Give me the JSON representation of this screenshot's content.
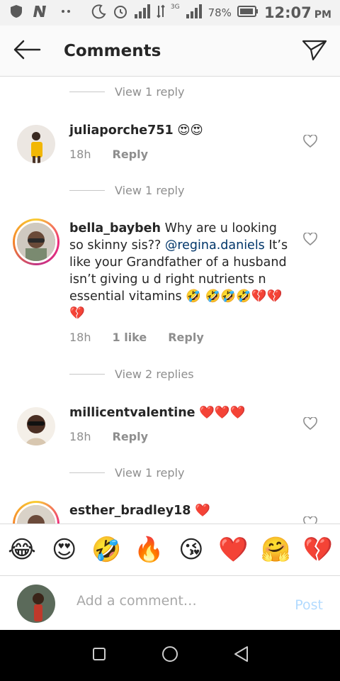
{
  "status_bar": {
    "battery_percent": "78%",
    "time": "12:07",
    "ampm": "PM",
    "network": "3G"
  },
  "header": {
    "title": "Comments"
  },
  "comments": [
    {
      "view_replies_above": "View 1 reply"
    },
    {
      "username": "juliaporche751",
      "text": "😍😍",
      "time": "18h",
      "reply_label": "Reply",
      "likes": ""
    },
    {
      "view_replies_above": "View 1 reply",
      "username": "bella_baybeh",
      "text_before_mention": "Why are u looking so skinny sis?? ",
      "mention": "@regina.daniels",
      "text_after_mention": " It’s like your Grandfather of a husband isn’t giving u d right nutrients n essential vitamins 🤣 🤣🤣🤣💔💔💔",
      "time": "18h",
      "likes": "1 like",
      "reply_label": "Reply"
    },
    {
      "view_replies_above": "View 2 replies",
      "username": "millicentvalentine",
      "text": "❤️❤️❤️",
      "time": "18h",
      "reply_label": "Reply"
    },
    {
      "view_replies_above": "View 1 reply",
      "username": "esther_bradley18",
      "text": "❤️"
    }
  ],
  "emoji_bar": [
    "😂",
    "😍",
    "🤣",
    "🔥",
    "😘",
    "❤️",
    "🤗",
    "💔"
  ],
  "composer": {
    "placeholder": "Add a comment…",
    "post_label": "Post"
  },
  "icons": {
    "back": "arrow-left-icon",
    "share": "paper-plane-icon",
    "heart": "heart-outline-icon",
    "nav_recent": "square-icon",
    "nav_home": "circle-icon",
    "nav_back": "triangle-icon"
  },
  "colors": {
    "text": "#262626",
    "meta": "#8e8e8e",
    "mention": "#003569",
    "post_disabled": "#b3dbff",
    "story_ring": "#ee2a7b"
  }
}
